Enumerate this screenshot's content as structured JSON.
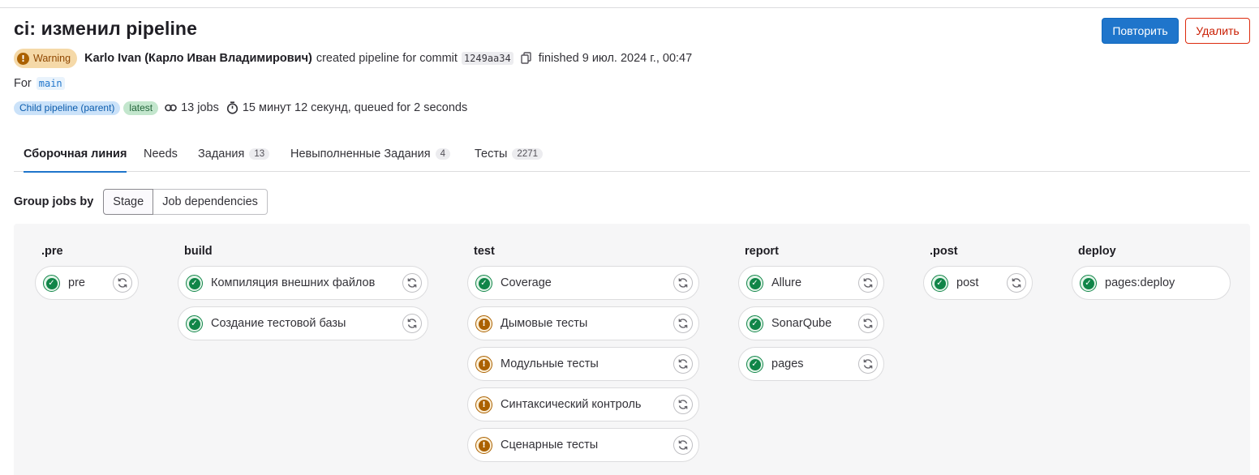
{
  "pipeline": {
    "title": "ci: изменил pipeline",
    "status_label": "Warning",
    "author": "Karlo Ivan (Карло Иван Владимирович)",
    "created_text": "created pipeline for commit",
    "commit_sha": "1249aa34",
    "finished_text": "finished 9 июл. 2024 г., 00:47",
    "for_label": "For",
    "ref": "main",
    "tag_child": "Child pipeline (parent)",
    "tag_latest": "latest",
    "jobs_count": "13 jobs",
    "duration": "15 минут 12 секунд, queued for 2 seconds"
  },
  "actions": {
    "retry_label": "Повторить",
    "delete_label": "Удалить"
  },
  "tabs": [
    {
      "label": "Сборочная линия",
      "count": ""
    },
    {
      "label": "Needs",
      "count": ""
    },
    {
      "label": "Задания",
      "count": "13"
    },
    {
      "label": "Невыполненные Задания",
      "count": "4"
    },
    {
      "label": "Тесты",
      "count": "2271"
    }
  ],
  "grouping": {
    "label": "Group jobs by",
    "options": [
      "Stage",
      "Job dependencies"
    ],
    "selected": "Stage"
  },
  "stages": [
    {
      "name": ".pre",
      "jobs": [
        {
          "name": "pre",
          "status": "success",
          "retry": true
        }
      ]
    },
    {
      "name": "build",
      "jobs": [
        {
          "name": "Компиляция внешних файлов",
          "status": "success",
          "retry": true
        },
        {
          "name": "Создание тестовой базы",
          "status": "success",
          "retry": true
        }
      ]
    },
    {
      "name": "test",
      "jobs": [
        {
          "name": "Coverage",
          "status": "success",
          "retry": true
        },
        {
          "name": "Дымовые тесты",
          "status": "warning",
          "retry": true
        },
        {
          "name": "Модульные тесты",
          "status": "warning",
          "retry": true
        },
        {
          "name": "Синтаксический контроль",
          "status": "warning",
          "retry": true
        },
        {
          "name": "Сценарные тесты",
          "status": "warning",
          "retry": true
        }
      ]
    },
    {
      "name": "report",
      "jobs": [
        {
          "name": "Allure",
          "status": "success",
          "retry": true
        },
        {
          "name": "SonarQube",
          "status": "success",
          "retry": true
        },
        {
          "name": "pages",
          "status": "success",
          "retry": true
        }
      ]
    },
    {
      "name": ".post",
      "jobs": [
        {
          "name": "post",
          "status": "success",
          "retry": true
        }
      ]
    },
    {
      "name": "deploy",
      "jobs": [
        {
          "name": "pages:deploy",
          "status": "success",
          "retry": false
        }
      ]
    }
  ],
  "colors": {
    "primary": "#1f75cb",
    "danger": "#dd2b0e",
    "success": "#108548",
    "warning": "#ab6100"
  },
  "icons": {
    "status_success": "check-circle-icon",
    "status_warning": "warning-circle-icon",
    "retry": "retry-icon",
    "copy": "copy-icon",
    "jobs": "link-icon",
    "duration": "timer-icon"
  }
}
